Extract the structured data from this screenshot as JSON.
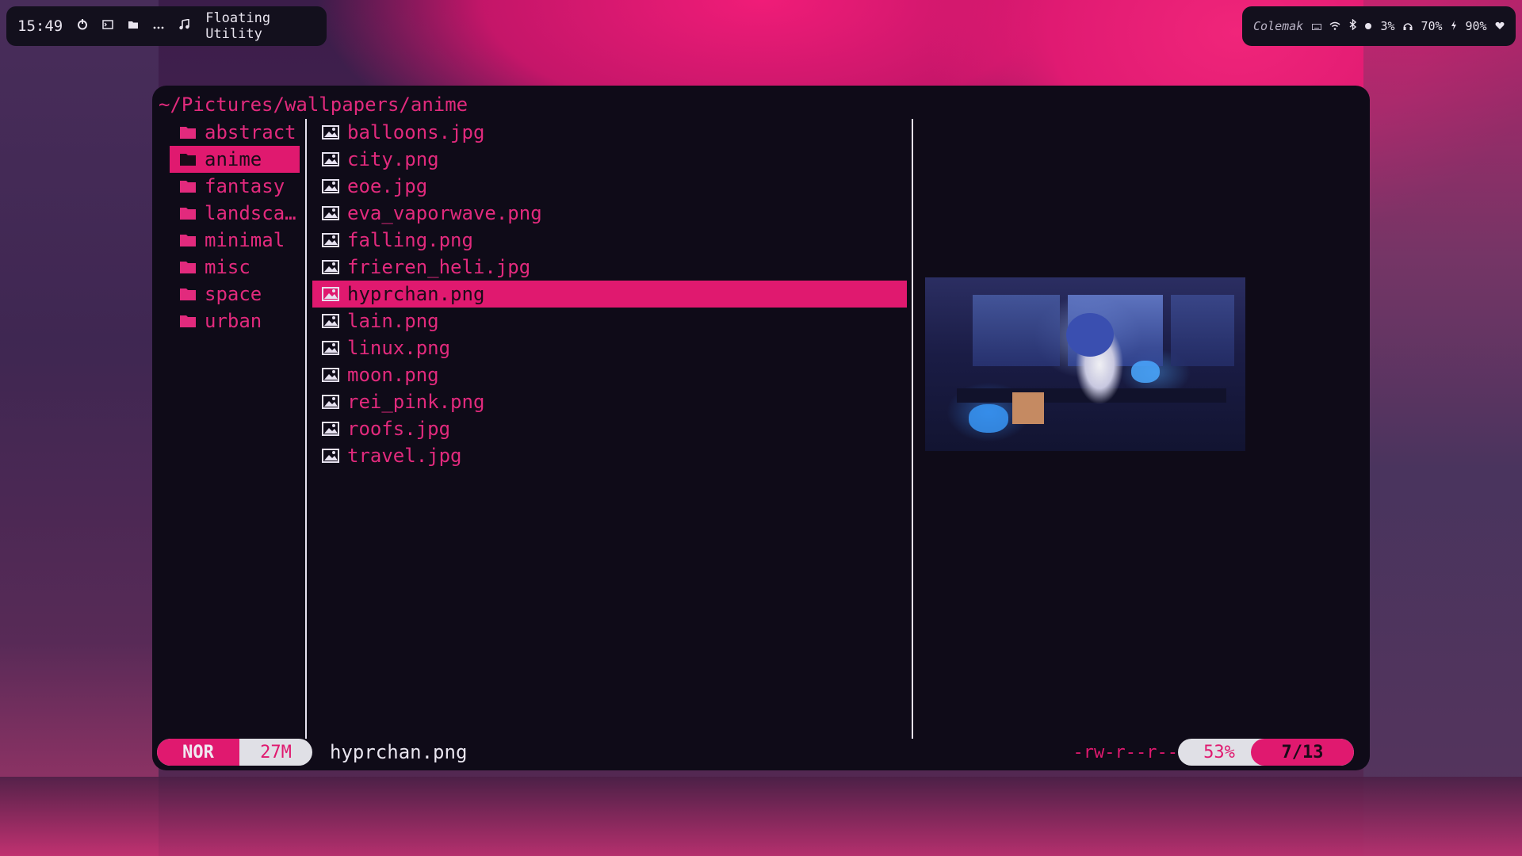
{
  "topbar": {
    "clock": "15:49",
    "icons": [
      "power-icon",
      "terminal-icon",
      "folder-icon",
      "more-icon",
      "music-icon"
    ],
    "window_title": "Floating Utility",
    "layout": "Colemak",
    "cpu": "3%",
    "volume": "70%",
    "battery": "90%"
  },
  "file_manager": {
    "path": "~/Pictures/wallpapers/anime",
    "parent_dirs": [
      {
        "name": "abstract"
      },
      {
        "name": "anime",
        "selected": true
      },
      {
        "name": "fantasy"
      },
      {
        "name": "landsca…"
      },
      {
        "name": "minimal"
      },
      {
        "name": "misc"
      },
      {
        "name": "space"
      },
      {
        "name": "urban"
      }
    ],
    "files": [
      {
        "name": "balloons.jpg"
      },
      {
        "name": "city.png"
      },
      {
        "name": "eoe.jpg"
      },
      {
        "name": "eva_vaporwave.png"
      },
      {
        "name": "falling.png"
      },
      {
        "name": "frieren_heli.jpg"
      },
      {
        "name": "hyprchan.png",
        "selected": true
      },
      {
        "name": "lain.png"
      },
      {
        "name": "linux.png"
      },
      {
        "name": "moon.png"
      },
      {
        "name": "rei_pink.png"
      },
      {
        "name": "roofs.jpg"
      },
      {
        "name": "travel.jpg"
      }
    ],
    "status": {
      "mode": "NOR",
      "size": "27M",
      "filename": "hyprchan.png",
      "permissions": "-rw-r--r--",
      "percent": "53%",
      "position": "7/13"
    }
  },
  "colors": {
    "accent": "#e0196f",
    "window_bg": "#0f0b18",
    "text_light": "#eae6f0"
  }
}
